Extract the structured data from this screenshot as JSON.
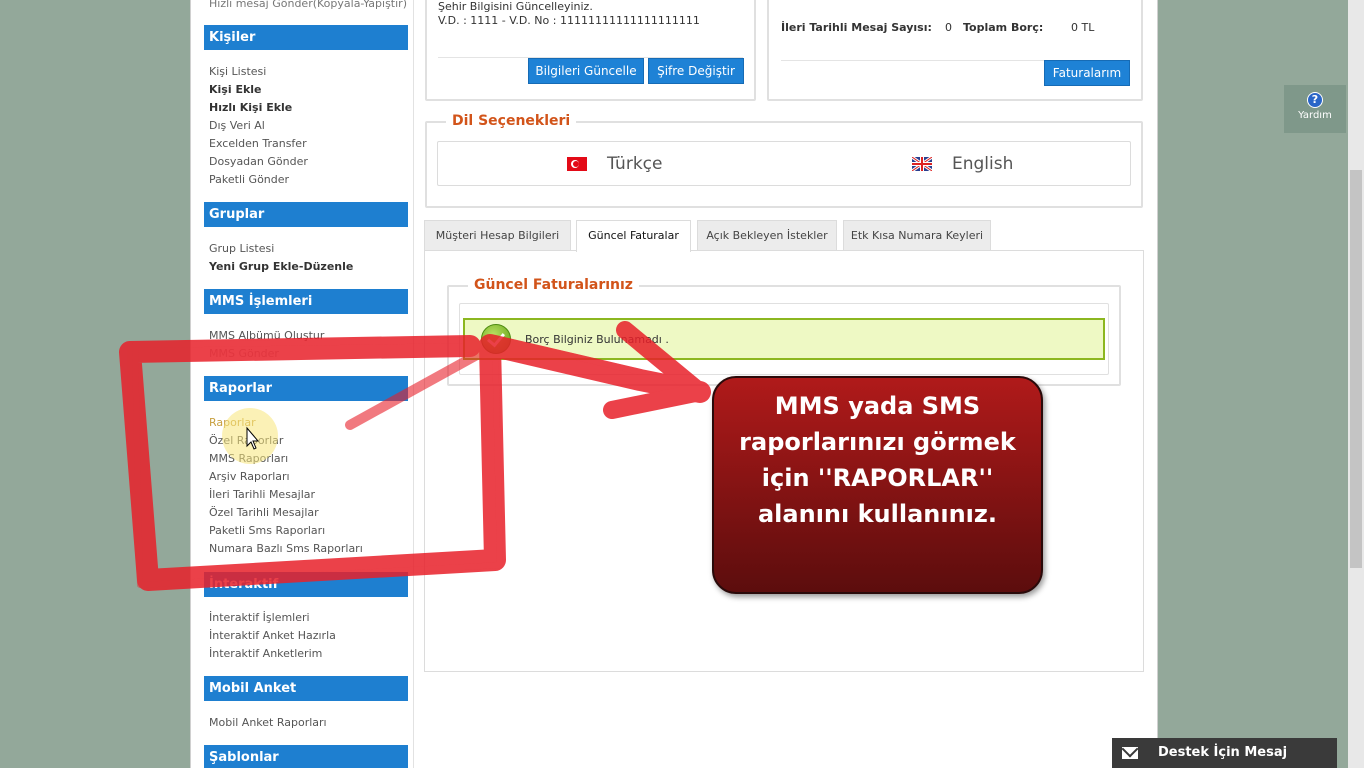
{
  "sidebar": {
    "cut_item": "Hızlı mesaj Gönder(Kopyala-Yapıştır)",
    "sections": {
      "kisiler": {
        "title": "Kişiler",
        "items": [
          "Kişi Listesi",
          "Kişi Ekle",
          "Hızlı Kişi Ekle",
          "Dış Veri Al",
          "Excelden Transfer",
          "Dosyadan Gönder",
          "Paketli Gönder"
        ]
      },
      "gruplar": {
        "title": "Gruplar",
        "items": [
          "Grup Listesi",
          "Yeni Grup Ekle-Düzenle"
        ]
      },
      "mms": {
        "title": "MMS İşlemleri",
        "items": [
          "MMS Albümü Oluştur",
          "MMS Gönder"
        ]
      },
      "raporlar": {
        "title": "Raporlar",
        "items": [
          "Raporlar",
          "Özel Raporlar",
          "MMS Raporları",
          "Arşiv Raporları",
          "İleri Tarihli Mesajlar",
          "Özel Tarihli Mesajlar",
          "Paketli Sms Raporları",
          "Numara Bazlı Sms Raporları"
        ]
      },
      "interaktif": {
        "title": "İnteraktif",
        "items": [
          "İnteraktif İşlemleri",
          "İnteraktif Anket Hazırla",
          "İnteraktif Anketlerim"
        ]
      },
      "mobil": {
        "title": "Mobil Anket",
        "items": [
          "Mobil Anket Raporları"
        ]
      },
      "sablonlar": {
        "title": "Şablonlar"
      }
    }
  },
  "account_box": {
    "line1": "Şehir Bilgisini Güncelleyiniz.",
    "line2": "V.D. : 1111 - V.D. No : 11111111111111111111",
    "update_button": "Bilgileri Güncelle",
    "password_button": "Şifre Değiştir"
  },
  "billing_box": {
    "future_label": "İleri Tarihli Mesaj Sayısı:",
    "future_value": "0",
    "debt_label": "Toplam Borç:",
    "debt_value": "0 TL",
    "invoices_button": "Faturalarım"
  },
  "language": {
    "legend": "Dil Seçenekleri",
    "turkish": "Türkçe",
    "english": "English"
  },
  "tabs": [
    "Müşteri Hesap Bilgileri",
    "Güncel Faturalar",
    "Açık Bekleyen İstekler",
    "Etk Kısa Numara Keyleri"
  ],
  "active_tab": "Güncel Faturalar",
  "invoices": {
    "legend": "Güncel Faturalarınız",
    "message": "Borç Bilginiz Bulunamadı ."
  },
  "callout": {
    "text": "MMS yada SMS raporlarınızı görmek için ''RAPORLAR'' alanını kullanınız."
  },
  "help": {
    "label": "Yardım"
  },
  "support": {
    "label": "Destek İçin Mesaj Bırakın"
  },
  "colors": {
    "accent": "#1e7fd0",
    "legend": "#d2541a",
    "callout": "#8b1414",
    "annotation": "#e8202a"
  }
}
